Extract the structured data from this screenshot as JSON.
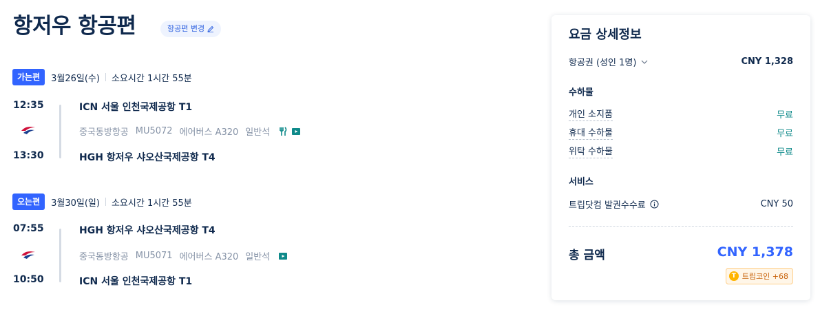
{
  "header": {
    "title": "항저우 항공편",
    "change_label": "항공편 변경"
  },
  "outbound": {
    "badge": "가는편",
    "date": "3월26일(수)",
    "duration": "소요시간 1시간 55분",
    "depart_time": "12:35",
    "arrive_time": "13:30",
    "depart_airport": "ICN 서울 인천국제공항 T1",
    "arrive_airport": "HGH 항저우 샤오산국제공항 T4",
    "airline": "중국동방항공",
    "flight_no": "MU5072",
    "aircraft": "에어버스 A320",
    "cabin": "일반석",
    "amenities": [
      "meal-icon",
      "entertainment-icon"
    ]
  },
  "return": {
    "badge": "오는편",
    "date": "3월30일(일)",
    "duration": "소요시간 1시간 55분",
    "depart_time": "07:55",
    "arrive_time": "10:50",
    "depart_airport": "HGH 항저우 샤오산국제공항 T4",
    "arrive_airport": "ICN 서울 인천국제공항 T1",
    "airline": "중국동방항공",
    "flight_no": "MU5071",
    "aircraft": "에어버스 A320",
    "cabin": "일반석",
    "amenities": [
      "entertainment-icon"
    ]
  },
  "fare": {
    "title": "요금 상세정보",
    "ticket_label": "항공권 (성인 1명)",
    "ticket_price": "CNY 1,328",
    "baggage_title": "수하물",
    "baggage": [
      {
        "label": "개인 소지품",
        "value": "무료"
      },
      {
        "label": "휴대 수하물",
        "value": "무료"
      },
      {
        "label": "위탁 수하물",
        "value": "무료"
      }
    ],
    "service_title": "서비스",
    "service_fee_label": "트립닷컴 발권수수료",
    "service_fee_value": "CNY 50",
    "total_label": "총 금액",
    "total_value": "CNY 1,378",
    "coin_label": "트립코인 +68",
    "coin_symbol": "T"
  },
  "colors": {
    "accent": "#3264ff",
    "text": "#0f294d",
    "muted": "#8592a6",
    "free": "#0f8a8a",
    "coin": "#ffb400"
  }
}
